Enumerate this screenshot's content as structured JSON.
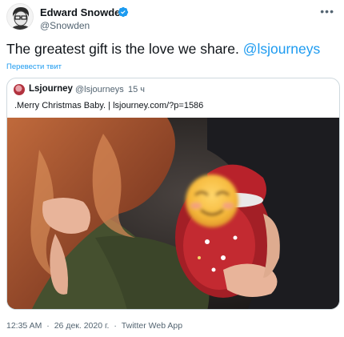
{
  "author": {
    "name": "Edward Snowden",
    "handle": "@Snowden",
    "verified_badge_color": "#1d9bf0",
    "more_icon": "ellipsis-icon"
  },
  "tweet": {
    "text": "The greatest gift is the love we share.",
    "mention": "@lsjourneys",
    "translate_label": "Перевести твит"
  },
  "quoted_tweet": {
    "name": "Lsjourney",
    "handle": "@lsjourneys",
    "separator": "·",
    "time": "15 ч",
    "text": ".Merry Christmas Baby. | lsjourney.com/?p=1586",
    "image_overlay_icon": "smiling-face-emoji-icon"
  },
  "footer": {
    "time": "12:35 AM",
    "separator": "·",
    "date": "26 дек. 2020 г.",
    "source": "Twitter Web App"
  },
  "colors": {
    "accent": "#1d9bf0",
    "text_primary": "#0f1419",
    "text_secondary": "#536471",
    "border": "#cfd9de"
  }
}
